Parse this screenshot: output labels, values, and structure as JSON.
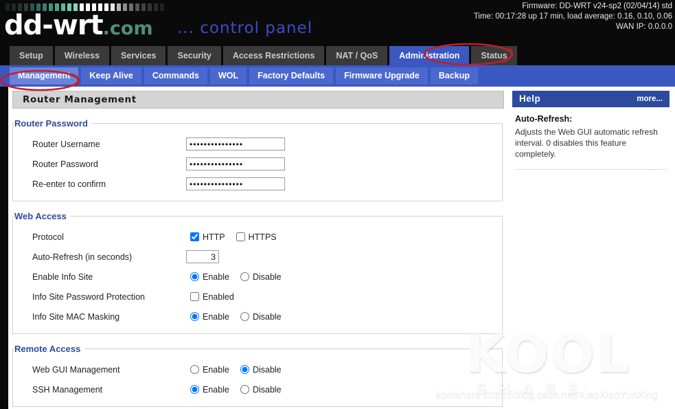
{
  "header": {
    "logo_main": "dd-wrt",
    "logo_suffix": ".com",
    "tagline": "... control panel",
    "firmware": "Firmware: DD-WRT v24-sp2 (02/04/14) std",
    "time": "Time: 00:17:28 up 17 min, load average: 0.16, 0.10, 0.06",
    "wan_ip": "WAN IP: 0.0.0.0"
  },
  "tabs": [
    {
      "label": "Setup",
      "active": false
    },
    {
      "label": "Wireless",
      "active": false
    },
    {
      "label": "Services",
      "active": false
    },
    {
      "label": "Security",
      "active": false
    },
    {
      "label": "Access Restrictions",
      "active": false
    },
    {
      "label": "NAT / QoS",
      "active": false
    },
    {
      "label": "Administration",
      "active": true
    },
    {
      "label": "Status",
      "active": false
    }
  ],
  "subtabs": [
    {
      "label": "Management",
      "active": true
    },
    {
      "label": "Keep Alive",
      "active": false
    },
    {
      "label": "Commands",
      "active": false
    },
    {
      "label": "WOL",
      "active": false
    },
    {
      "label": "Factory Defaults",
      "active": false
    },
    {
      "label": "Firmware Upgrade",
      "active": false
    },
    {
      "label": "Backup",
      "active": false
    }
  ],
  "page_title": "Router Management",
  "sections": {
    "router_password": {
      "legend": "Router Password",
      "username_label": "Router Username",
      "username_value": "•••••••••••••••",
      "password_label": "Router Password",
      "password_value": "•••••••••••••••",
      "confirm_label": "Re-enter to confirm",
      "confirm_value": "•••••••••••••••"
    },
    "web_access": {
      "legend": "Web Access",
      "protocol_label": "Protocol",
      "http_label": "HTTP",
      "http_checked": true,
      "https_label": "HTTPS",
      "https_checked": false,
      "autorefresh_label": "Auto-Refresh (in seconds)",
      "autorefresh_value": "3",
      "info_site_label": "Enable Info Site",
      "info_site_enable": "Enable",
      "info_site_disable": "Disable",
      "info_site_selected": "Enable",
      "info_pw_label": "Info Site Password Protection",
      "info_pw_enabled_label": "Enabled",
      "info_pw_checked": false,
      "mac_mask_label": "Info Site MAC Masking",
      "mac_mask_enable": "Enable",
      "mac_mask_disable": "Disable",
      "mac_mask_selected": "Enable"
    },
    "remote_access": {
      "legend": "Remote Access",
      "webgui_label": "Web GUI Management",
      "webgui_enable": "Enable",
      "webgui_disable": "Disable",
      "webgui_selected": "Disable",
      "ssh_label": "SSH Management",
      "ssh_enable": "Enable",
      "ssh_disable": "Disable",
      "ssh_selected": "Enable"
    }
  },
  "help": {
    "title": "Help",
    "more": "more...",
    "entry_title": "Auto-Refresh:",
    "entry_text": "Adjusts the Web GUI automatic refresh interval. 0 disables this feature completely."
  },
  "watermark": {
    "brand": "KOOL",
    "sub": "SHARE",
    "url": "koolshare https://blog.csdn.net/XiaoXiaoYunXing"
  },
  "colors": {
    "header_bg": "#0a0a0a",
    "tab_active": "#3a58c0",
    "subtab_bar": "#3a58c0",
    "subtab_active": "#6a83da",
    "legend_blue": "#2e4a9e",
    "annotation_red": "#c0202a"
  }
}
